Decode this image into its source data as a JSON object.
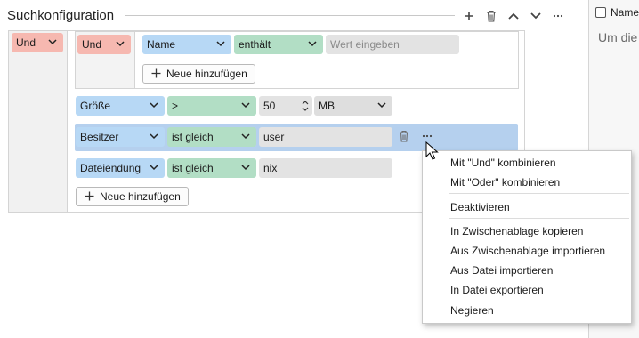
{
  "header": {
    "title": "Suchkonfiguration",
    "toolbar": [
      {
        "name": "add-icon"
      },
      {
        "name": "trash-icon"
      },
      {
        "name": "chevron-up-icon"
      },
      {
        "name": "chevron-down-icon"
      },
      {
        "name": "more-icon"
      }
    ]
  },
  "right_panel": {
    "column_label": "Name",
    "empty_text": "Um die… Start."
  },
  "tree": {
    "outer_operator": "Und",
    "inner_operator": "Und",
    "inner_rules": [
      {
        "field": "Name",
        "op": "enthält",
        "value": "",
        "placeholder": "Wert eingeben"
      }
    ],
    "inner_add_label": "Neue hinzufügen",
    "rules": [
      {
        "field": "Größe",
        "op": ">",
        "value": "50",
        "unit": "MB"
      },
      {
        "field": "Besitzer",
        "op": "ist gleich",
        "value": "user"
      },
      {
        "field": "Dateiendung",
        "op": "ist gleich",
        "value": "nix"
      }
    ],
    "add_label": "Neue hinzufügen"
  },
  "context_menu": {
    "items": [
      "Mit \"Und\" kombinieren",
      "Mit \"Oder\" kombinieren",
      "Deaktivieren",
      "In Zwischenablage kopieren",
      "Aus Zwischenablage importieren",
      "Aus Datei importieren",
      "In Datei exportieren",
      "Negieren"
    ]
  },
  "colors": {
    "operator": "#f6b8b0",
    "field": "#b7d8f5",
    "comparator": "#b2dec5",
    "selected_row": "#b5d0ee"
  }
}
